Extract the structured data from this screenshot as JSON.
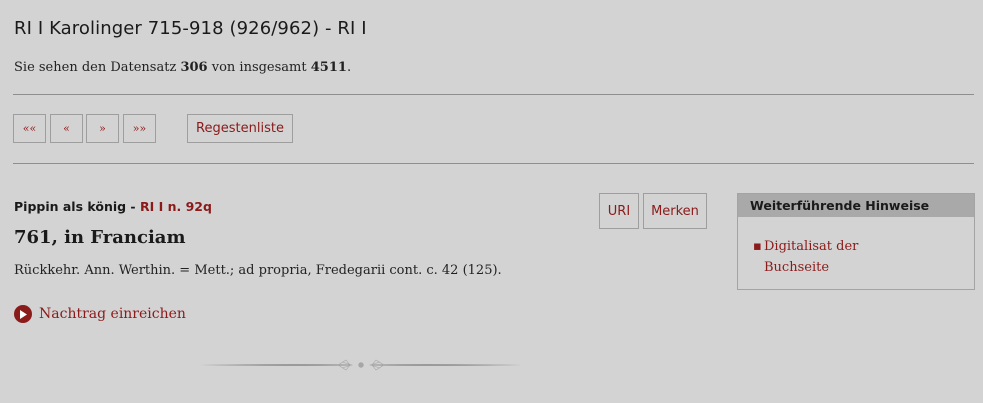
{
  "title": "RI I Karolinger 715-918 (926/962) - RI I",
  "record_info": {
    "prefix": "Sie sehen den Datensatz",
    "current": "306",
    "middle": "von insgesamt",
    "total": "4511",
    "suffix": "."
  },
  "nav": {
    "first": "««",
    "prev": "«",
    "next": "»",
    "last": "»»",
    "list": "Regestenliste"
  },
  "regest": {
    "label": "Pippin als könig - ",
    "reference": "RI I n. 92q",
    "heading": "761, in Franciam",
    "text": "Rückkehr. Ann. Werthin. = Mett.; ad propria, Fredegarii cont. c. 42 (125).",
    "uri_button": "URI",
    "merken_button": "Merken",
    "nachtrag": "Nachtrag einreichen"
  },
  "sidebar": {
    "heading": "Weiterführende Hinweise",
    "links": [
      {
        "line1": "Digitalisat der",
        "line2": "Buchseite"
      }
    ]
  },
  "colors": {
    "background": "#d3d3d3",
    "accent": "#8b1a1a",
    "sidebar_header": "#a9a9a9"
  },
  "icons": {
    "nachtrag": "play-circle-icon",
    "ornament": "decorative-divider"
  }
}
